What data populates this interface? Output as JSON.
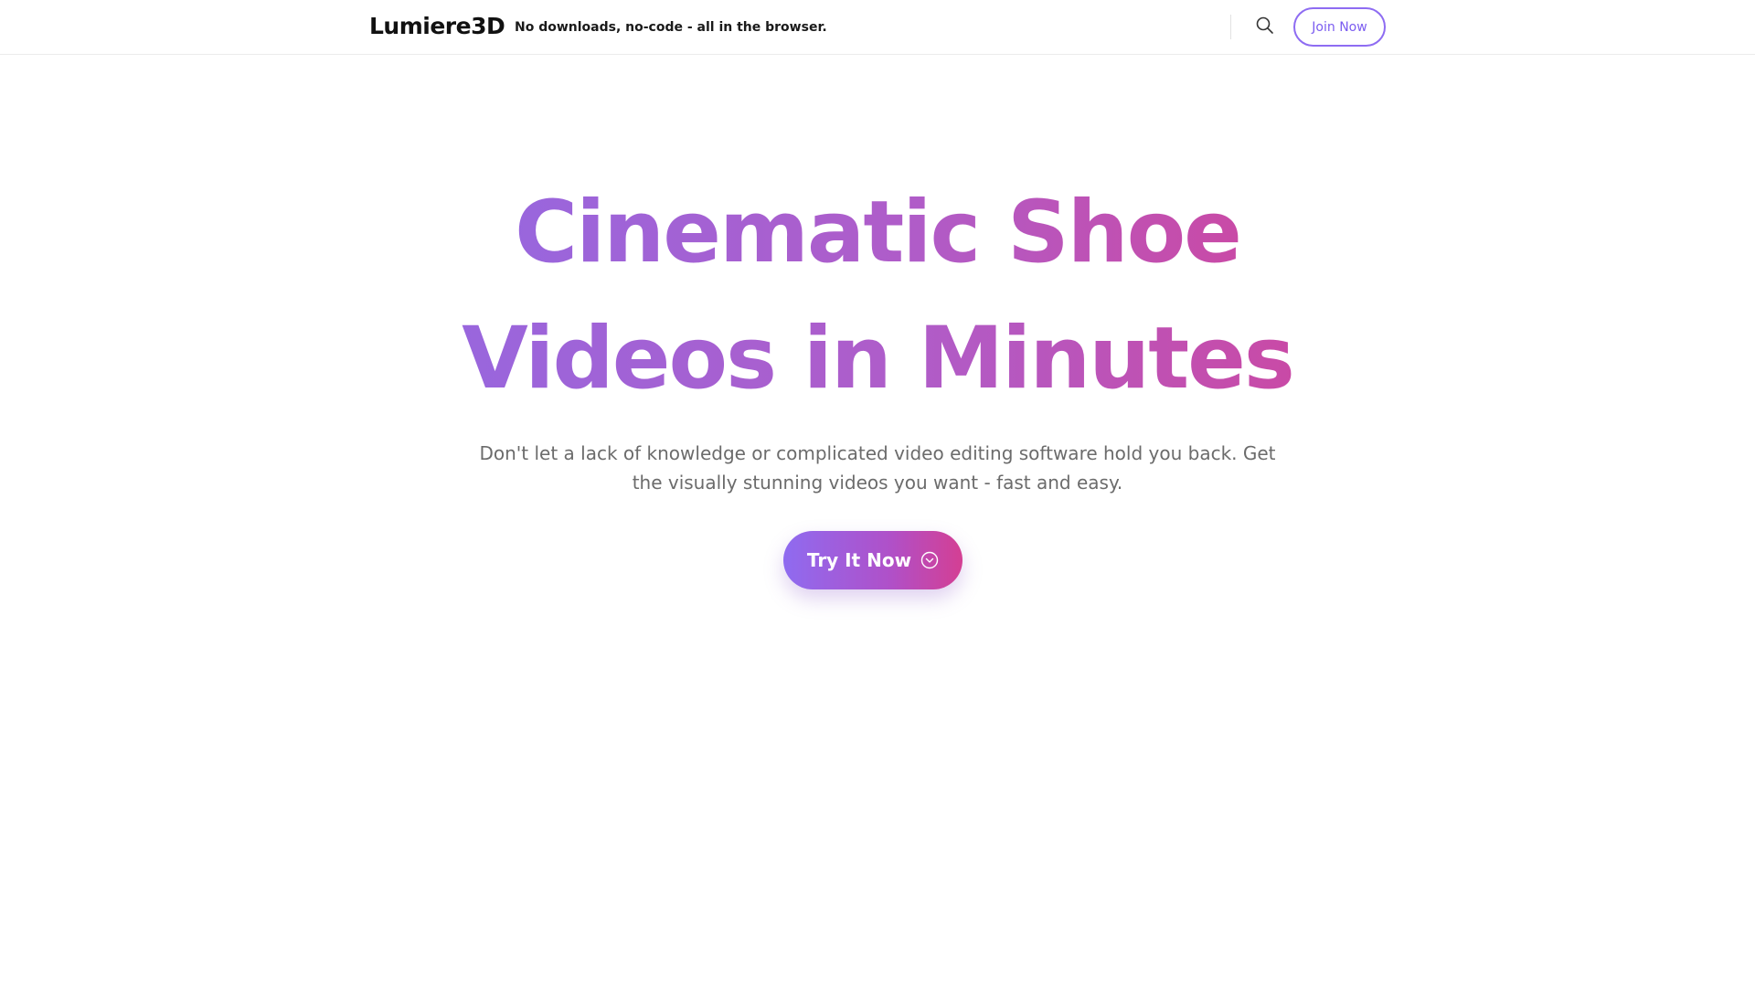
{
  "header": {
    "logo": "Lumiere3D",
    "tagline": "No downloads, no-code - all in the browser.",
    "search_icon": "search-icon",
    "join_label": "Join Now"
  },
  "hero": {
    "title_line1": "Cinematic Shoe",
    "title_line2": "Videos in Minutes",
    "subtitle": "Don't let a lack of knowledge or complicated video editing software hold you back. Get the visually stunning videos you want - fast and easy.",
    "cta_label": "Try It Now",
    "cta_icon": "chevron-down-circle-icon"
  },
  "colors": {
    "accent_start": "#8f6bf0",
    "accent_end": "#d43f93",
    "join_border": "#8e6cf2",
    "subtitle_text": "#6b6b6b"
  }
}
